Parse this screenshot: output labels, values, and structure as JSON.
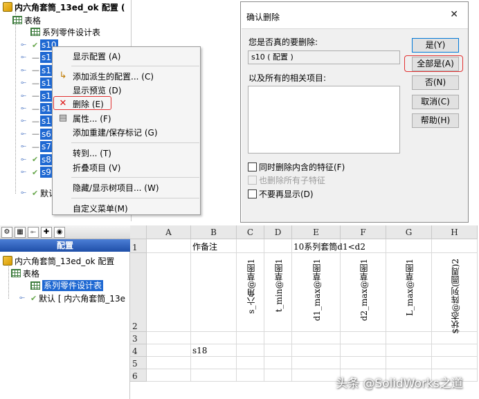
{
  "top_tree": {
    "root_label": "内六角套筒_13ed_ok 配置 (",
    "tables_label": "表格",
    "design_table_label": "系列零件设计表",
    "config_rows": [
      {
        "label": "s10",
        "state": "check",
        "selected": true
      },
      {
        "label": "s1",
        "state": "dash",
        "selected": true
      },
      {
        "label": "s1",
        "state": "dash",
        "selected": true
      },
      {
        "label": "s1",
        "state": "dash",
        "selected": true
      },
      {
        "label": "s1",
        "state": "dash",
        "selected": true
      },
      {
        "label": "s1",
        "state": "dash",
        "selected": true
      },
      {
        "label": "s1",
        "state": "dash",
        "selected": true
      },
      {
        "label": "s6",
        "state": "dash",
        "selected": true
      },
      {
        "label": "s7",
        "state": "dash",
        "selected": true
      },
      {
        "label": "s8",
        "state": "check",
        "selected": true
      },
      {
        "label": "s9",
        "state": "check",
        "selected": true
      }
    ],
    "default_label": "默认"
  },
  "context_menu": {
    "items": [
      {
        "label": "显示配置 (A)",
        "icon": ""
      },
      {
        "label": "添加派生的配置... (C)",
        "icon": "derived-config-icon"
      },
      {
        "label": "显示预览 (D)",
        "icon": ""
      },
      {
        "label": "删除 (E)",
        "icon": "delete-x-icon"
      },
      {
        "label": "属性... (F)",
        "icon": "properties-icon"
      },
      {
        "label": "添加重建/保存标记 (G)",
        "icon": ""
      },
      {
        "label": "转到... (T)",
        "icon": ""
      },
      {
        "label": "折叠项目 (V)",
        "icon": ""
      },
      {
        "label": "隐藏/显示树项目... (W)",
        "icon": ""
      },
      {
        "label": "自定义菜单(M)",
        "icon": ""
      }
    ]
  },
  "dialog": {
    "title": "确认删除",
    "close_glyph": "✕",
    "question": "您是否真的要删除:",
    "item": "s10 ( 配置 )",
    "related_label": "以及所有的相关项目:",
    "buttons": {
      "yes": "是(Y)",
      "yes_all": "全部是(A)",
      "no": "否(N)",
      "cancel": "取消(C)",
      "help": "帮助(H)"
    },
    "checkboxes": {
      "delete_features": "同时删除内含的特征(F)",
      "delete_children": "也删除所有子特征",
      "dont_show": "不要再显示(D)"
    }
  },
  "bottom_panel": {
    "title": "配置",
    "root_label": "内六角套筒_13ed_ok 配置",
    "tables_label": "表格",
    "design_table_label": "系列零件设计表",
    "default_label": "默认 [ 内六角套筒_13e"
  },
  "sheet": {
    "columns": [
      "A",
      "B",
      "C",
      "D",
      "E",
      "F",
      "G",
      "H"
    ],
    "rows": [
      "1",
      "2",
      "3",
      "4",
      "5",
      "6"
    ],
    "b1": "作备注",
    "e1": "10系列套筒d1<d2",
    "headers": [
      "s_六角@草图1",
      "t_min@草图1",
      "d1_max@草图1",
      "d2_max@草图1",
      "L_max@草图1",
      "$状态@阵列(圆周)2"
    ],
    "b4": "s18"
  },
  "watermark": "头条 @SolidWorks之道"
}
